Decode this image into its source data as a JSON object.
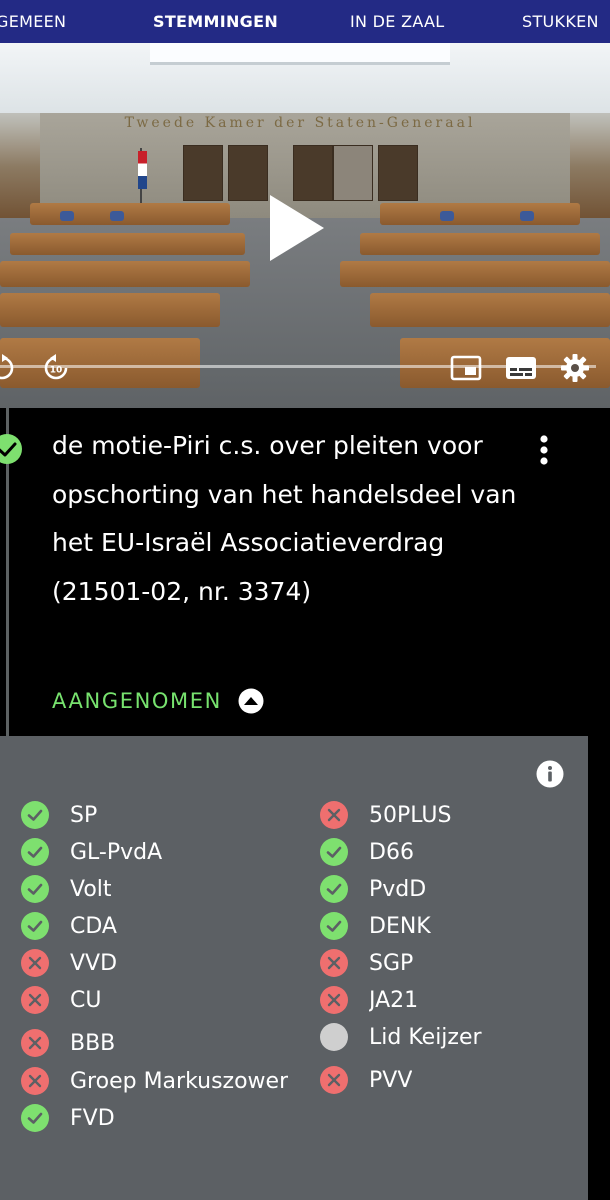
{
  "tabs": [
    {
      "label": "GEMEEN",
      "active": false
    },
    {
      "label": "STEMMINGEN",
      "active": true
    },
    {
      "label": "IN DE ZAAL",
      "active": false
    },
    {
      "label": "STUKKEN",
      "active": false
    }
  ],
  "video": {
    "wall_text": "Tweede Kamer der Staten-Generaal",
    "play_icon": "play-icon",
    "rewind_icon": "rewind-10-icon",
    "forward_label": "10",
    "pip_icon": "picture-in-picture-icon",
    "subtitles_icon": "subtitles-icon",
    "settings_icon": "gear-icon"
  },
  "motion": {
    "title": "de motie-Piri c.s. over pleiten voor opschorting van het handelsdeel van het EU-Israël Associatieverdrag (21501-02, nr. 3374)",
    "result": "AANGENOMEN",
    "result_color": "#77e26e"
  },
  "colors": {
    "tabbar": "#232a85",
    "for": "#7ee06f",
    "against": "#ef6f6f",
    "absent": "#cfcfcf",
    "panel": "#5c6064"
  },
  "parties_left": [
    {
      "name": "SP",
      "vote": "for"
    },
    {
      "name": "GL-PvdA",
      "vote": "for"
    },
    {
      "name": "Volt",
      "vote": "for"
    },
    {
      "name": "CDA",
      "vote": "for"
    },
    {
      "name": "VVD",
      "vote": "against"
    },
    {
      "name": "CU",
      "vote": "against"
    },
    {
      "name": "BBB",
      "vote": "against"
    },
    {
      "name": "Groep Markuszower",
      "vote": "against"
    },
    {
      "name": "FVD",
      "vote": "for"
    }
  ],
  "parties_right": [
    {
      "name": "50PLUS",
      "vote": "against"
    },
    {
      "name": "D66",
      "vote": "for"
    },
    {
      "name": "PvdD",
      "vote": "for"
    },
    {
      "name": "DENK",
      "vote": "for"
    },
    {
      "name": "SGP",
      "vote": "against"
    },
    {
      "name": "JA21",
      "vote": "against"
    },
    {
      "name": "Lid Keijzer",
      "vote": "absent"
    },
    {
      "name": "PVV",
      "vote": "against"
    }
  ]
}
